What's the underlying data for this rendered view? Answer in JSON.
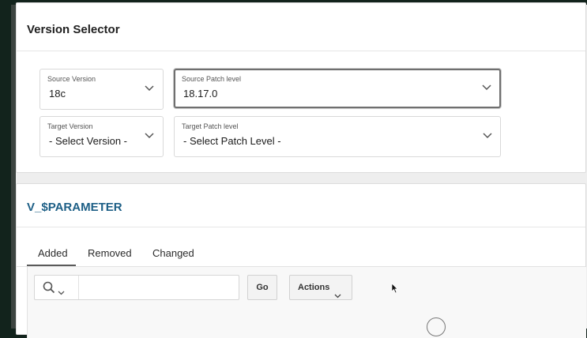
{
  "version_selector": {
    "title": "Version Selector",
    "source_version": {
      "label": "Source Version",
      "value": "18c"
    },
    "source_patch": {
      "label": "Source Patch level",
      "value": "18.17.0"
    },
    "target_version": {
      "label": "Target Version",
      "value": "- Select Version -"
    },
    "target_patch": {
      "label": "Target Patch level",
      "value": "- Select Patch Level -"
    }
  },
  "parameter_region": {
    "title": "V_$PARAMETER",
    "tabs": [
      {
        "label": "Added",
        "selected": true
      },
      {
        "label": "Removed",
        "selected": false
      },
      {
        "label": "Changed",
        "selected": false
      }
    ],
    "toolbar": {
      "search_value": "",
      "go_label": "Go",
      "actions_label": "Actions"
    }
  },
  "icons": [
    "search-icon",
    "chevron-down-icon",
    "mouse-cursor-icon"
  ]
}
